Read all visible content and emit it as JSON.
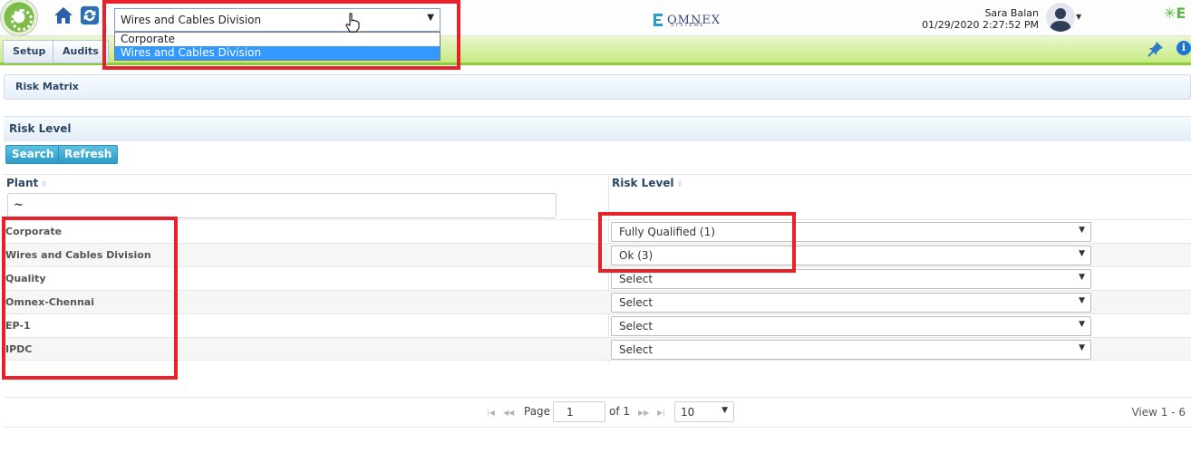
{
  "header": {
    "plant_select": {
      "value": "Wires and Cables Division",
      "options": [
        "Corporate",
        "Wires and Cables Division"
      ],
      "highlighted": "Wires and Cables Division"
    },
    "brand_name": "OMNEX",
    "brand_sub": "SYSTEMS",
    "user_name": "Sara Balan",
    "datetime": "01/29/2020 2:27:52 PM",
    "right_logo_letter": "E",
    "icons": [
      "app-logo-icon",
      "home-icon",
      "refresh-icon",
      "cursor-hand-icon",
      "user-avatar-icon",
      "pin-icon",
      "info-icon"
    ]
  },
  "nav": {
    "items": [
      "Setup",
      "Audits"
    ]
  },
  "breadcrumb": "Risk Matrix",
  "panel": {
    "title": "Risk Level",
    "buttons": {
      "search": "Search",
      "refresh": "Refresh"
    }
  },
  "grid": {
    "columns": [
      "Plant",
      "Risk Level"
    ],
    "filter_value": "~",
    "rows": [
      {
        "plant": "Corporate",
        "risk_level": "Fully Qualified (1)"
      },
      {
        "plant": "Wires and Cables Division",
        "risk_level": "Ok (3)"
      },
      {
        "plant": "Quality",
        "risk_level": "Select"
      },
      {
        "plant": "Omnex-Chennai",
        "risk_level": "Select"
      },
      {
        "plant": "EP-1",
        "risk_level": "Select"
      },
      {
        "plant": "IPDC",
        "risk_level": "Select"
      }
    ]
  },
  "pager": {
    "page_label": "Page",
    "page_value": "1",
    "of_label": "of 1",
    "page_size": "10",
    "view_text": "View 1 - 6"
  },
  "colors": {
    "highlight_red": "#e8202a",
    "nav_green": "#c7ea82",
    "selection_blue": "#3399ff",
    "header_text": "#2b4666"
  }
}
